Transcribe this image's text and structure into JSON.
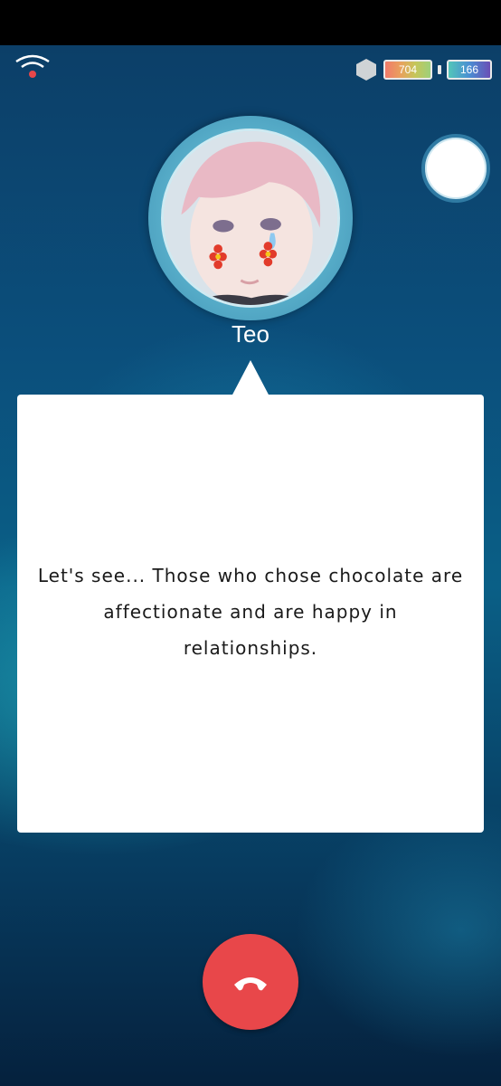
{
  "hud": {
    "hourglass_count": "704",
    "battery_count": "166"
  },
  "call": {
    "caller_name": "Teo",
    "message": "Let's see... Those who chose chocolate are affectionate and are happy in relationships."
  },
  "colors": {
    "hangup": "#e8474a",
    "bubble": "#ffffff",
    "background_top": "#0c3f68",
    "background_bottom": "#05213d"
  },
  "icons": [
    "wifi-icon",
    "hexagon-icon",
    "phone-hangup-icon"
  ]
}
